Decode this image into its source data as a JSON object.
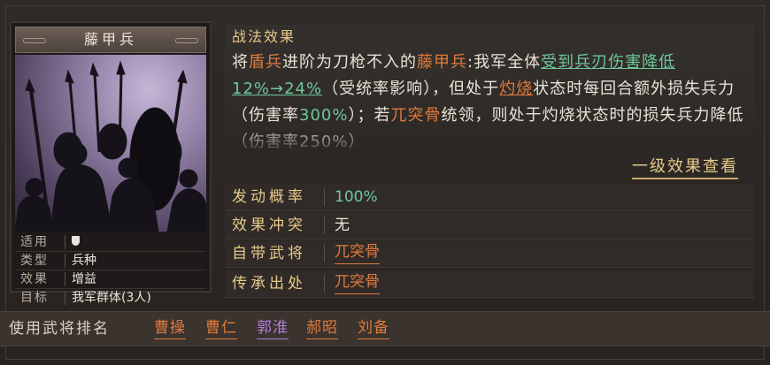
{
  "card": {
    "title": "藤甲兵",
    "props": [
      {
        "label": "适用",
        "value": "",
        "icon": "shield-icon"
      },
      {
        "label": "类型",
        "value": "兵种"
      },
      {
        "label": "效果",
        "value": "增益"
      },
      {
        "label": "目标",
        "value": "我军群体(3人)"
      }
    ]
  },
  "effect": {
    "section_title": "战法效果",
    "segments": [
      {
        "text": "将",
        "style": ""
      },
      {
        "text": "盾兵",
        "style": "o"
      },
      {
        "text": "进阶为刀枪不入的",
        "style": ""
      },
      {
        "text": "藤甲兵",
        "style": "o"
      },
      {
        "text": ":我军全体",
        "style": ""
      },
      {
        "text": "受到兵刃伤害降低12%→24%",
        "style": "g u"
      },
      {
        "text": "（受统率影响），但处于",
        "style": ""
      },
      {
        "text": "灼烧",
        "style": "o u"
      },
      {
        "text": "状态时每回合额外损失兵力（伤害率",
        "style": ""
      },
      {
        "text": "300%",
        "style": "g"
      },
      {
        "text": "）；若",
        "style": ""
      },
      {
        "text": "兀突骨",
        "style": "o"
      },
      {
        "text": "统领，则处于灼烧状态时的损失兵力降低（伤害率250%）",
        "style": ""
      }
    ],
    "more_link": "一级效果查看"
  },
  "info": {
    "rows": [
      {
        "label": "发动概率",
        "value": "100%",
        "style": "green"
      },
      {
        "label": "效果冲突",
        "value": "无",
        "style": "plain"
      },
      {
        "label": "自带武将",
        "value": "兀突骨",
        "style": "link"
      },
      {
        "label": "传承出处",
        "value": "兀突骨",
        "style": "link"
      }
    ]
  },
  "ranking": {
    "label": "使用武将排名",
    "generals": [
      {
        "name": "曹操",
        "color": "#e07a3c"
      },
      {
        "name": "曹仁",
        "color": "#e07a3c"
      },
      {
        "name": "郭淮",
        "color": "#b27fd6"
      },
      {
        "name": "郝昭",
        "color": "#e07a3c"
      },
      {
        "name": "刘备",
        "color": "#e07a3c"
      }
    ]
  }
}
